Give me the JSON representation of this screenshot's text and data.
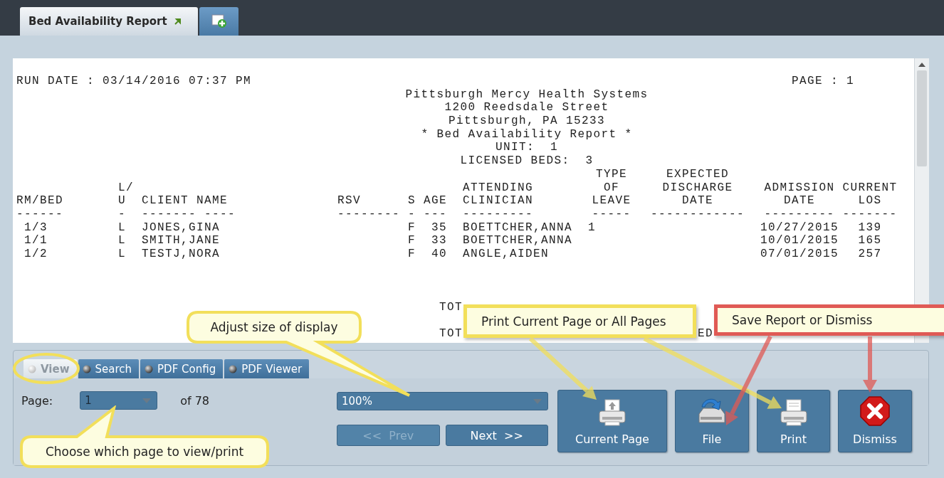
{
  "tabs": [
    {
      "label": "Bed Availability Report",
      "selected": true
    }
  ],
  "report": {
    "run_date": "RUN DATE : 03/14/2016 07:37 PM",
    "page": "PAGE : 1",
    "title_lines": [
      "Pittsburgh Mercy Health Systems",
      "1200 Reedsdale Street",
      "Pittsburgh, PA 15233",
      "* Bed Availability Report *",
      "UNIT:  1",
      "LICENSED BEDS:  3"
    ],
    "columns": [
      {
        "heading": [
          "RM/BED"
        ],
        "rule": "------"
      },
      {
        "heading": [
          "L/",
          "U"
        ],
        "rule": "-"
      },
      {
        "heading": [
          "CLIENT NAME"
        ],
        "rule": "------- ----"
      },
      {
        "heading": [
          "RSV"
        ],
        "rule": "--------"
      },
      {
        "heading": [
          "S"
        ],
        "rule": "-"
      },
      {
        "heading": [
          "AGE"
        ],
        "rule": "---"
      },
      {
        "heading": [
          "ATTENDING",
          "CLINICIAN"
        ],
        "rule": "---------"
      },
      {
        "heading": [
          "TYPE",
          "OF",
          "LEAVE"
        ],
        "rule": "-----"
      },
      {
        "heading": [
          "EXPECTED",
          "DISCHARGE",
          "DATE"
        ],
        "rule": "------------"
      },
      {
        "heading": [
          "ADMISSION",
          "DATE"
        ],
        "rule": "---------"
      },
      {
        "heading": [
          "CURRENT",
          "LOS"
        ],
        "rule": "-------"
      }
    ],
    "rows": [
      {
        "rm_bed": "1/3",
        "l_u": "L",
        "client_name": "JONES,GINA",
        "s": "F",
        "age": "35",
        "attending_clinician": "BOETTCHER,ANNA",
        "type_of_leave": "1",
        "admission_date": "10/27/2015",
        "current_los": "139"
      },
      {
        "rm_bed": "1/1",
        "l_u": "L",
        "client_name": "SMITH,JANE",
        "s": "F",
        "age": "33",
        "attending_clinician": "BOETTCHER,ANNA",
        "admission_date": "10/01/2015",
        "current_los": "165"
      },
      {
        "rm_bed": "1/2",
        "l_u": "L",
        "client_name": "TESTJ,NORA",
        "s": "F",
        "age": "40",
        "attending_clinician": "ANGLE,AIDEN",
        "admission_date": "07/01/2015",
        "current_los": "257"
      }
    ],
    "totals": [
      {
        "fragments": [
          "TOT"
        ]
      },
      {
        "fragments": [
          "TOT",
          "ED"
        ]
      }
    ]
  },
  "view_tabs": [
    {
      "label": "View",
      "selected": true
    },
    {
      "label": "Search",
      "selected": false
    },
    {
      "label": "PDF Config",
      "selected": false
    },
    {
      "label": "PDF Viewer",
      "selected": false
    }
  ],
  "page_label": "Page:",
  "page_select": {
    "value": "1"
  },
  "page_count": "of 78",
  "zoom_select": {
    "value": "100%"
  },
  "nav_buttons": [
    {
      "label": "<<  Prev",
      "disabled": true
    },
    {
      "label": "Next  >>",
      "disabled": false
    }
  ],
  "action_buttons": [
    {
      "kind": "current_page",
      "label": "Current Page"
    },
    {
      "kind": "file",
      "label": "File"
    },
    {
      "kind": "print",
      "label": "Print"
    },
    {
      "kind": "dismiss",
      "label": "Dismiss"
    }
  ],
  "annotations": [
    {
      "kind": "bubble",
      "text": "Adjust size of display",
      "color": "#f2df5a"
    },
    {
      "kind": "bubble",
      "text": "Choose which page to view/print",
      "color": "#f2df5a"
    },
    {
      "kind": "box",
      "text": "Print Current Page or All Pages",
      "color": "#f2df5a"
    },
    {
      "kind": "box",
      "text": "Save Report or Dismiss",
      "color": "#e05a55"
    },
    {
      "kind": "ellipse",
      "color": "#f2df5a"
    }
  ]
}
